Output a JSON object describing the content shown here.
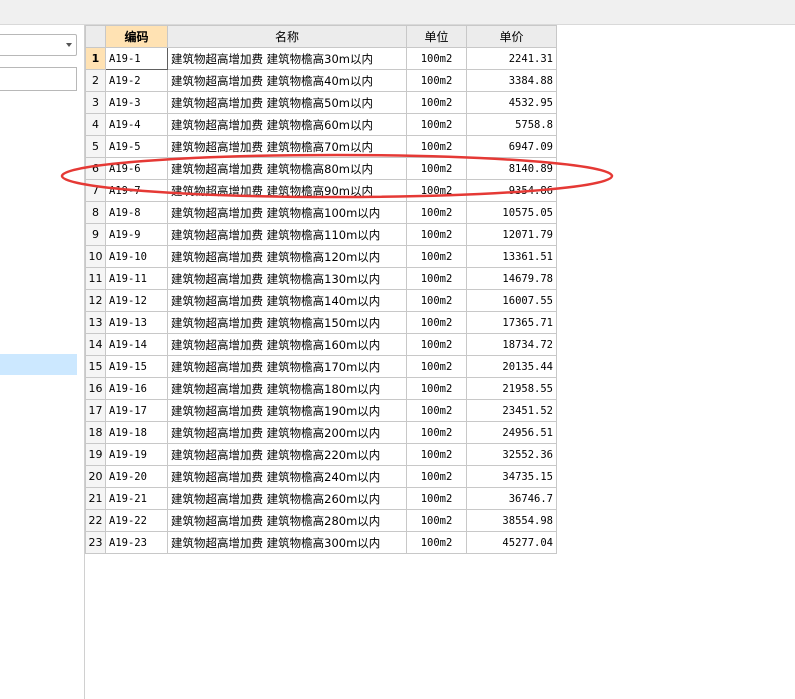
{
  "table": {
    "headers": {
      "code": "编码",
      "name": "名称",
      "unit": "单位",
      "price": "单价"
    },
    "rows": [
      {
        "num": "1",
        "code": "A19-1",
        "name": "建筑物超高增加费 建筑物檐高30m以内",
        "unit": "100m2",
        "price": "2241.31"
      },
      {
        "num": "2",
        "code": "A19-2",
        "name": "建筑物超高增加费 建筑物檐高40m以内",
        "unit": "100m2",
        "price": "3384.88"
      },
      {
        "num": "3",
        "code": "A19-3",
        "name": "建筑物超高增加费 建筑物檐高50m以内",
        "unit": "100m2",
        "price": "4532.95"
      },
      {
        "num": "4",
        "code": "A19-4",
        "name": "建筑物超高增加费 建筑物檐高60m以内",
        "unit": "100m2",
        "price": "5758.8"
      },
      {
        "num": "5",
        "code": "A19-5",
        "name": "建筑物超高增加费 建筑物檐高70m以内",
        "unit": "100m2",
        "price": "6947.09"
      },
      {
        "num": "6",
        "code": "A19-6",
        "name": "建筑物超高增加费 建筑物檐高80m以内",
        "unit": "100m2",
        "price": "8140.89"
      },
      {
        "num": "7",
        "code": "A19-7",
        "name": "建筑物超高增加费 建筑物檐高90m以内",
        "unit": "100m2",
        "price": "9354.86"
      },
      {
        "num": "8",
        "code": "A19-8",
        "name": "建筑物超高增加费 建筑物檐高100m以内",
        "unit": "100m2",
        "price": "10575.05"
      },
      {
        "num": "9",
        "code": "A19-9",
        "name": "建筑物超高增加费 建筑物檐高110m以内",
        "unit": "100m2",
        "price": "12071.79"
      },
      {
        "num": "10",
        "code": "A19-10",
        "name": "建筑物超高增加费 建筑物檐高120m以内",
        "unit": "100m2",
        "price": "13361.51"
      },
      {
        "num": "11",
        "code": "A19-11",
        "name": "建筑物超高增加费 建筑物檐高130m以内",
        "unit": "100m2",
        "price": "14679.78"
      },
      {
        "num": "12",
        "code": "A19-12",
        "name": "建筑物超高增加费 建筑物檐高140m以内",
        "unit": "100m2",
        "price": "16007.55"
      },
      {
        "num": "13",
        "code": "A19-13",
        "name": "建筑物超高增加费 建筑物檐高150m以内",
        "unit": "100m2",
        "price": "17365.71"
      },
      {
        "num": "14",
        "code": "A19-14",
        "name": "建筑物超高增加费 建筑物檐高160m以内",
        "unit": "100m2",
        "price": "18734.72"
      },
      {
        "num": "15",
        "code": "A19-15",
        "name": "建筑物超高增加费 建筑物檐高170m以内",
        "unit": "100m2",
        "price": "20135.44"
      },
      {
        "num": "16",
        "code": "A19-16",
        "name": "建筑物超高增加费 建筑物檐高180m以内",
        "unit": "100m2",
        "price": "21958.55"
      },
      {
        "num": "17",
        "code": "A19-17",
        "name": "建筑物超高增加费 建筑物檐高190m以内",
        "unit": "100m2",
        "price": "23451.52"
      },
      {
        "num": "18",
        "code": "A19-18",
        "name": "建筑物超高增加费 建筑物檐高200m以内",
        "unit": "100m2",
        "price": "24956.51"
      },
      {
        "num": "19",
        "code": "A19-19",
        "name": "建筑物超高增加费 建筑物檐高220m以内",
        "unit": "100m2",
        "price": "32552.36"
      },
      {
        "num": "20",
        "code": "A19-20",
        "name": "建筑物超高增加费 建筑物檐高240m以内",
        "unit": "100m2",
        "price": "34735.15"
      },
      {
        "num": "21",
        "code": "A19-21",
        "name": "建筑物超高增加费 建筑物檐高260m以内",
        "unit": "100m2",
        "price": "36746.7"
      },
      {
        "num": "22",
        "code": "A19-22",
        "name": "建筑物超高增加费 建筑物檐高280m以内",
        "unit": "100m2",
        "price": "38554.98"
      },
      {
        "num": "23",
        "code": "A19-23",
        "name": "建筑物超高增加费 建筑物檐高300m以内",
        "unit": "100m2",
        "price": "45277.04"
      }
    ]
  },
  "colors": {
    "selected_header": "#ffe2b3",
    "selection_highlight": "#cce8ff",
    "annotation": "#e53935"
  }
}
